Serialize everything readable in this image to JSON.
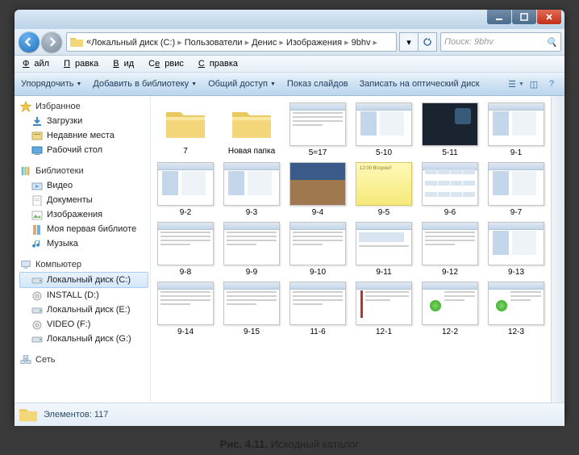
{
  "breadcrumbs": [
    "Локальный диск (C:)",
    "Пользователи",
    "Денис",
    "Изображения",
    "9bhv"
  ],
  "search_placeholder": "Поиск: 9bhv",
  "menu": {
    "file": "Файл",
    "edit": "Правка",
    "view": "Вид",
    "service": "Сервис",
    "help": "Справка"
  },
  "toolbar": {
    "organize": "Упорядочить",
    "add_lib": "Добавить в библиотеку",
    "share": "Общий доступ",
    "slideshow": "Показ слайдов",
    "burn": "Записать на оптический диск"
  },
  "sidebar": {
    "favorites": {
      "title": "Избранное",
      "items": [
        "Загрузки",
        "Недавние места",
        "Рабочий стол"
      ]
    },
    "libraries": {
      "title": "Библиотеки",
      "items": [
        "Видео",
        "Документы",
        "Изображения",
        "Моя первая библиоте",
        "Музыка"
      ]
    },
    "computer": {
      "title": "Компьютер",
      "items": [
        "Локальный диск (C:)",
        "INSTALL (D:)",
        "Локальный диск (E:)",
        "VIDEO (F:)",
        "Локальный диск (G:)"
      ]
    },
    "network": {
      "title": "Сеть"
    }
  },
  "items": [
    {
      "name": "7",
      "type": "folder"
    },
    {
      "name": "Новая папка",
      "type": "folder"
    },
    {
      "name": "5=17",
      "type": "thumb",
      "v": "text"
    },
    {
      "name": "5-10",
      "type": "thumb",
      "v": "win"
    },
    {
      "name": "5-11",
      "type": "thumb",
      "v": "dark"
    },
    {
      "name": "9-1",
      "type": "thumb",
      "v": "win"
    },
    {
      "name": "9-2",
      "type": "thumb",
      "v": "win"
    },
    {
      "name": "9-3",
      "type": "thumb",
      "v": "win"
    },
    {
      "name": "9-4",
      "type": "thumb",
      "v": "photo"
    },
    {
      "name": "9-5",
      "type": "thumb",
      "v": "note",
      "note": "12:00 Второе!!"
    },
    {
      "name": "9-6",
      "type": "thumb",
      "v": "grid"
    },
    {
      "name": "9-7",
      "type": "thumb",
      "v": "win"
    },
    {
      "name": "9-8",
      "type": "thumb",
      "v": "text"
    },
    {
      "name": "9-9",
      "type": "thumb",
      "v": "text"
    },
    {
      "name": "9-10",
      "type": "thumb",
      "v": "text"
    },
    {
      "name": "9-11",
      "type": "thumb",
      "v": "wide"
    },
    {
      "name": "9-12",
      "type": "thumb",
      "v": "text"
    },
    {
      "name": "9-13",
      "type": "thumb",
      "v": "win"
    },
    {
      "name": "9-14",
      "type": "thumb",
      "v": "text"
    },
    {
      "name": "9-15",
      "type": "thumb",
      "v": "text"
    },
    {
      "name": "11-6",
      "type": "thumb",
      "v": "text"
    },
    {
      "name": "12-1",
      "type": "thumb",
      "v": "red"
    },
    {
      "name": "12-2",
      "type": "thumb",
      "v": "green"
    },
    {
      "name": "12-3",
      "type": "thumb",
      "v": "green"
    }
  ],
  "status": {
    "count_label": "Элементов:",
    "count": 117
  },
  "caption": {
    "prefix": "Рис. 4.11.",
    "text": "Исходный каталог"
  }
}
